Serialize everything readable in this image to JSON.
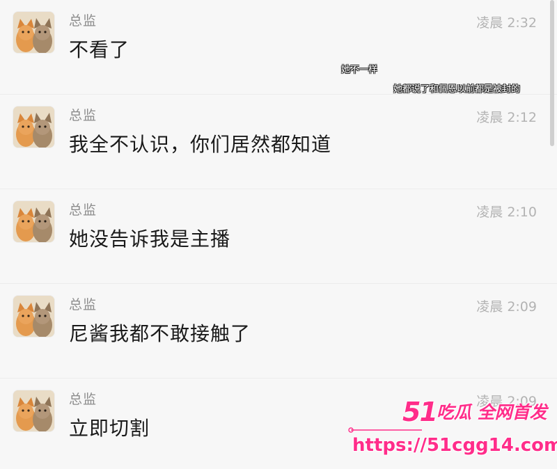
{
  "conversation": {
    "messages": [
      {
        "sender": "总监",
        "time": "凌晨 2:32",
        "text": "不看了",
        "avatar_icon": "cat-photo-avatar"
      },
      {
        "sender": "总监",
        "time": "凌晨 2:12",
        "text": "我全不认识，你们居然都知道",
        "avatar_icon": "cat-photo-avatar"
      },
      {
        "sender": "总监",
        "time": "凌晨 2:10",
        "text": "她没告诉我是主播",
        "avatar_icon": "cat-photo-avatar"
      },
      {
        "sender": "总监",
        "time": "凌晨 2:09",
        "text": "尼酱我都不敢接触了",
        "avatar_icon": "cat-photo-avatar"
      },
      {
        "sender": "总监",
        "time": "凌晨 2:09",
        "text": "立即切割",
        "avatar_icon": "cat-photo-avatar"
      }
    ]
  },
  "overlay": {
    "captions": [
      "她不一样",
      "她都说了和佩恩以前都是被封的"
    ]
  },
  "watermark": {
    "brand_number": "51",
    "brand_text": "吃瓜 全网首发",
    "url": "https://51cgg14.com"
  },
  "colors": {
    "background": "#f7f7f7",
    "sender": "#8c8c8c",
    "time": "#b3b3b3",
    "message_text": "#1a1a1a",
    "watermark": "#ff2d8a"
  }
}
